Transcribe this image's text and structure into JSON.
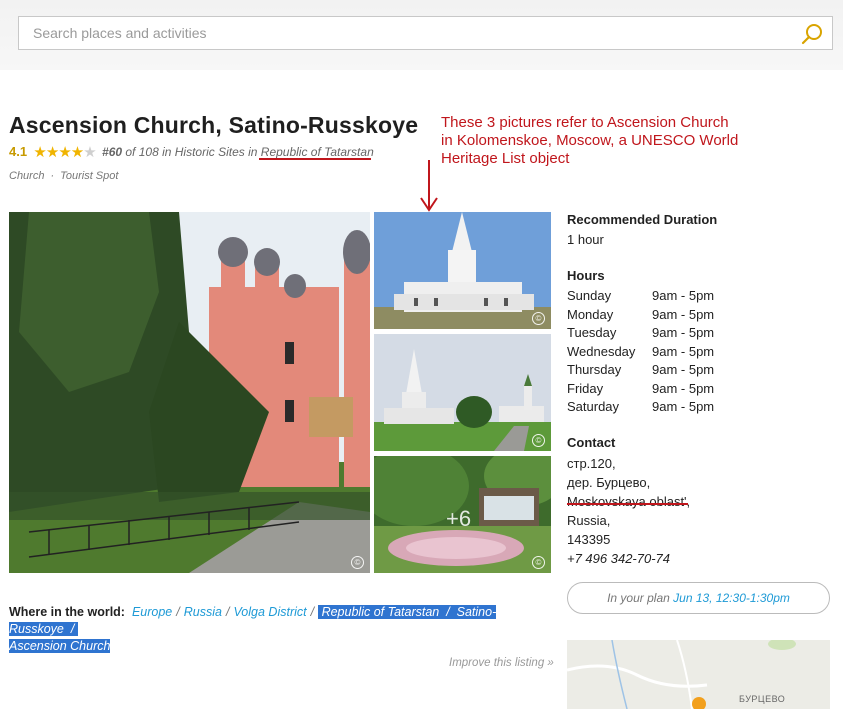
{
  "search": {
    "placeholder": "Search places and activities"
  },
  "attraction": {
    "title": "Ascension Church, Satino-Russkoye",
    "rating": "4.1",
    "stars": 4,
    "rank": "#60",
    "rank_suffix": " of 108 in Historic Sites in ",
    "region": "Republic of Tatarstan",
    "categories": [
      "Church",
      "Tourist Spot"
    ],
    "category_separator": "·"
  },
  "annotation": {
    "text": "These 3 pictures refer to Ascension Church in Kolomenskoe, Moscow, a UNESCO World Heritage List object",
    "color": "#c0161c"
  },
  "photos": {
    "copyright_symbol": "©",
    "more_count": "+6"
  },
  "details": {
    "duration_heading": "Recommended Duration",
    "duration_value": "1 hour",
    "hours_heading": "Hours",
    "hours": [
      {
        "day": "Sunday",
        "time": "9am - 5pm"
      },
      {
        "day": "Monday",
        "time": "9am - 5pm"
      },
      {
        "day": "Tuesday",
        "time": "9am - 5pm"
      },
      {
        "day": "Wednesday",
        "time": "9am - 5pm"
      },
      {
        "day": "Thursday",
        "time": "9am - 5pm"
      },
      {
        "day": "Friday",
        "time": "9am - 5pm"
      },
      {
        "day": "Saturday",
        "time": "9am - 5pm"
      }
    ],
    "contact_heading": "Contact",
    "address_lines": [
      "стр.120,",
      "дер. Бурцево,",
      "Moskovskaya oblast',",
      "Russia,",
      "143395"
    ],
    "phone": "+7 496 342-70-74"
  },
  "plan": {
    "prefix": "In your plan ",
    "datetime": "Jun 13, 12:30-1:30pm"
  },
  "map": {
    "label": "БУРЦЕВО"
  },
  "where": {
    "label": "Where in the world:",
    "links": [
      "Europe",
      "Russia",
      "Volga District"
    ],
    "highlighted": [
      "Republic of Tatarstan",
      "Satino-Russkoye",
      "Ascension Church"
    ],
    "separator": "/"
  },
  "improve": "Improve this listing »",
  "colors": {
    "link": "#1e9ad6",
    "star": "#f0b400",
    "rating": "#c79a00",
    "highlight": "#2f74d0"
  }
}
